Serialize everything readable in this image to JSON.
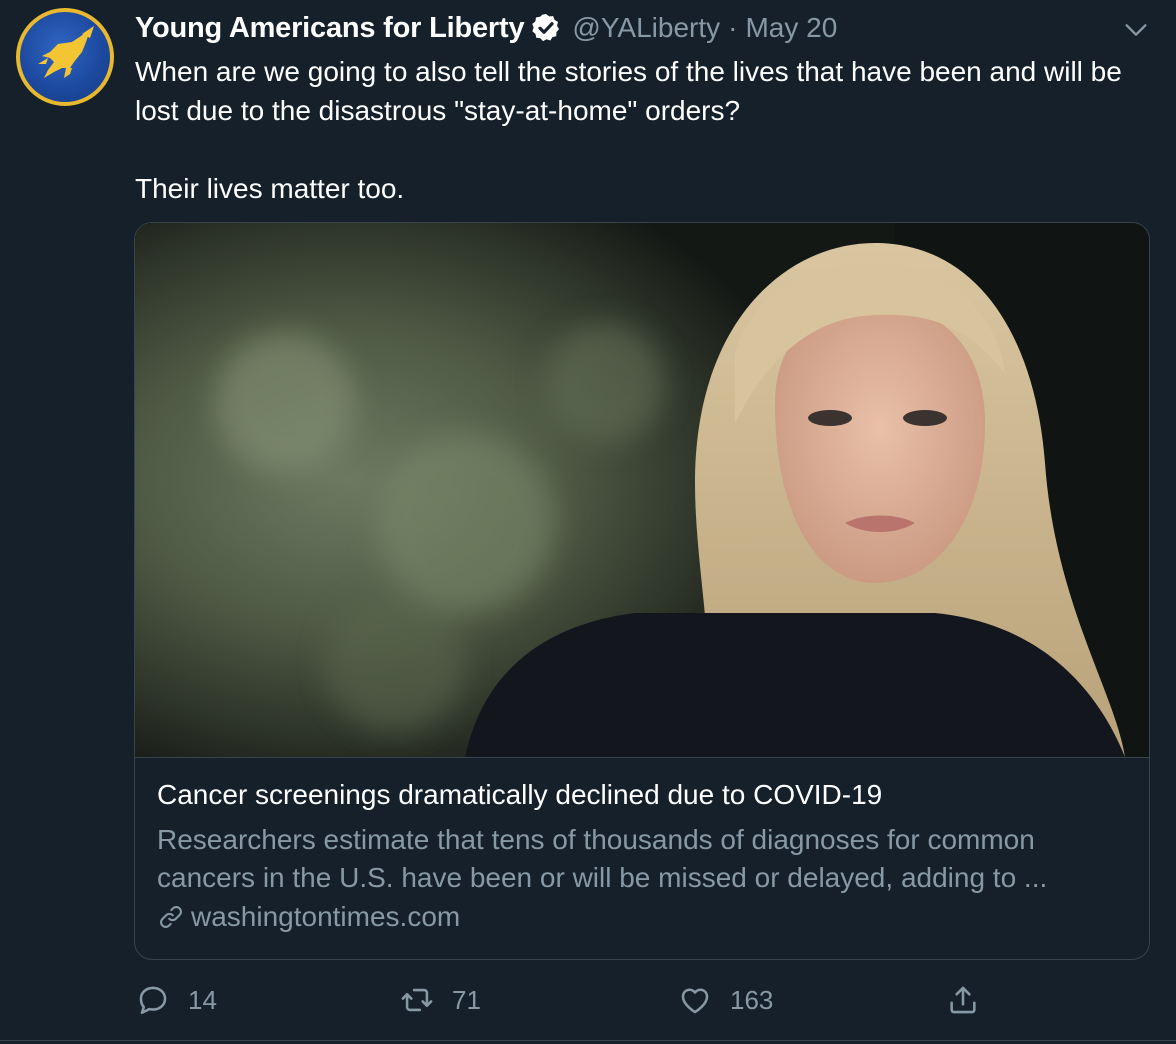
{
  "tweet": {
    "display_name": "Young Americans for Liberty",
    "handle": "@YALiberty",
    "separator": "·",
    "date": "May 20",
    "verified": true,
    "text_lines": [
      "When are we going to also tell the stories of the lives that have been and will be lost due to the disastrous \"stay-at-home\" orders?",
      "Their lives matter too."
    ]
  },
  "card": {
    "title": "Cancer screenings dramatically declined due to COVID-19",
    "description": "Researchers estimate that tens of thousands of diagnoses for common cancers in the U.S. have been or will be missed or delayed, adding to ...",
    "domain": "washingtontimes.com"
  },
  "actions": {
    "replies": "14",
    "retweets": "71",
    "likes": "163"
  },
  "icons": {
    "avatar": "eagle-logo",
    "verified": "verified-badge-icon",
    "more": "chevron-down-icon",
    "link": "link-icon",
    "reply": "reply-icon",
    "retweet": "retweet-icon",
    "like": "heart-icon",
    "share": "share-icon"
  },
  "colors": {
    "background": "#15202b",
    "text": "#ffffff",
    "muted": "#8899a6",
    "border": "#38444d",
    "avatar_ring": "#e8b92f",
    "avatar_fill": "#1d4aa0"
  }
}
